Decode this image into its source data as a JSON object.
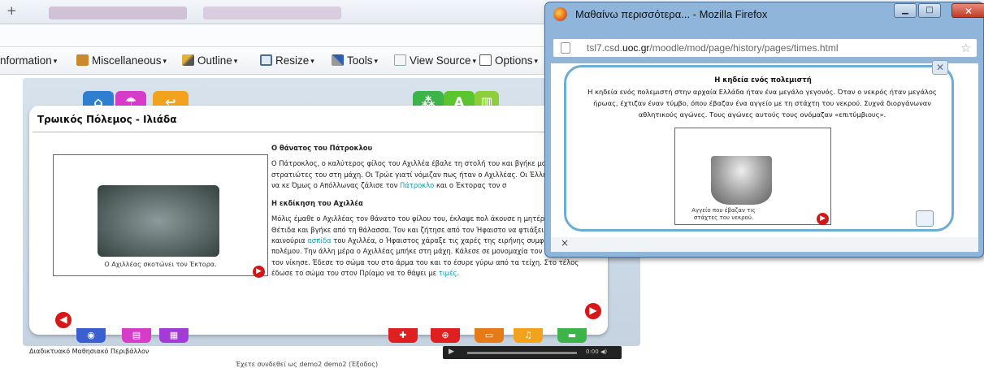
{
  "toolbar": {
    "items": [
      {
        "label": "nformation",
        "icon": "info-icon"
      },
      {
        "label": "Miscellaneous",
        "icon": "briefcase-icon"
      },
      {
        "label": "Outline",
        "icon": "pencil-icon"
      },
      {
        "label": "Resize",
        "icon": "resize-icon"
      },
      {
        "label": "Tools",
        "icon": "scissors-icon"
      },
      {
        "label": "View Source",
        "icon": "document-icon"
      },
      {
        "label": "Options",
        "icon": "options-icon"
      }
    ],
    "caret": "▾"
  },
  "lesson": {
    "title": "Τρωικός Πόλεμος - Ιλιάδα",
    "image_caption": "Ο Αχιλλέας σκοτώνει τον Έκτορα.",
    "section1_heading": "Ο θάνατος του Πάτροκλου",
    "section1_a": "Ο Πάτροκλος, ο καλύτερος φίλος του Αχιλλέα έβαλε τη στολή του και βγήκε μαζί με τους στρατιώτες του στη μάχη. Οι Τρώε γιατί νόμιζαν πως ήταν ο Αχιλλέας. Οι Έλληνες άρχισαν να κε Όμως ο Απόλλωνας ζάλισε τον ",
    "section1_link": "Πάτροκλο",
    "section1_b": " και ο Έκτορας τον σ",
    "section2_heading": "Η εκδίκηση του Αχιλλέα",
    "section2_a": "Μόλις έμαθε ο Αχιλλέας τον θάνατο του φίλου του, έκλαψε πολ άκουσε η μητέρα του η Θέτιδα και βγήκε από τη θάλασσα. Τον και ζήτησε από τον Ήφαιστο να φτιάξει στον γιό της καινούρια ",
    "section2_link1": "ασπίδα",
    "section2_b": " του Αχιλλέα, ο Ήφαιστος χάραξε τις χαρές της ειρήνης συμφορές του πολέμου. Την άλλη μέρα ο Αχιλλέας μπήκε στη μάχη. Κάλεσε σε μονομαχία τον Έκτορα και τον νίκησε. Έδεσε το σώμα του στο άρμα του και το έσυρε γύρω από τα τείχη. Στο τέλος έδωσε το σώμα του στον Πρίαμο να το θάψει με ",
    "section2_link2": "τιμές",
    "section2_c": ".",
    "footer": "Διαδικτυακό Μαθησιακό Περιβάλλον",
    "player_time": "0:00",
    "below_text": "Έχετε συνδεθεί ως demo2 demo2 (Έξοδος)"
  },
  "popup": {
    "window_title": "Μαθαίνω περισσότερα... - Mozilla Firefox",
    "url_prefix": "tsl7.csd.",
    "url_domain": "uoc.gr",
    "url_suffix": "/moodle/mod/page/history/pages/times.html",
    "heading": "Η κηδεία ενός πολεμιστή",
    "body": "Η κηδεία ενός πολεμιστή στην αρχαία Ελλάδα ήταν ένα μεγάλο γεγονός. Όταν ο νεκρός ήταν μεγάλος ήρωας, έχτιζαν έναν τύμβο, όπου έβαζαν ένα αγγείο με τη στάχτη του νεκρού. Συχνά διοργάνωναν αθλητικούς αγώνες. Τους αγώνες αυτούς τους ονόμαζαν «επιτύμβιους».",
    "image_caption": "Αγγείο που έβαζαν τις στάχτες του νεκρού.",
    "close_glyph": "✕",
    "status_close": "×",
    "accent": "#6aaed3"
  },
  "colors": {
    "red": "#d31616",
    "link": "#1798a8"
  }
}
